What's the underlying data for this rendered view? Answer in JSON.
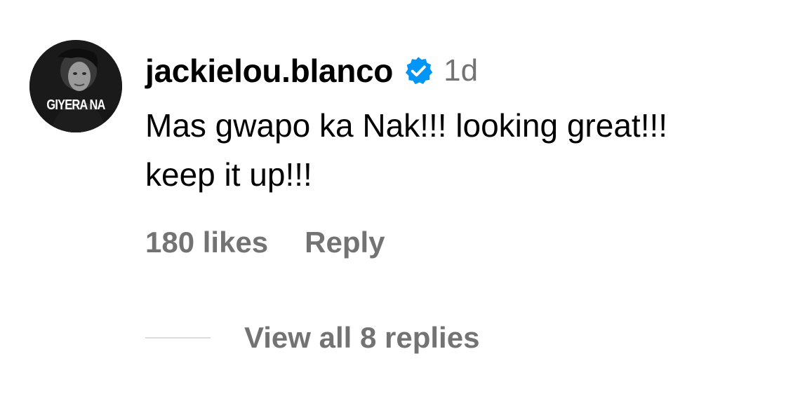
{
  "comment": {
    "avatar": {
      "text": "GIYERA NA"
    },
    "username": "jackielou.blanco",
    "verified": true,
    "verified_color": "#0095f6",
    "timestamp": "1d",
    "text": "Mas gwapo ka Nak!!! looking great!!! keep it up!!!",
    "likes_label": "180 likes",
    "reply_label": "Reply",
    "view_replies_label": "View all 8 replies"
  }
}
